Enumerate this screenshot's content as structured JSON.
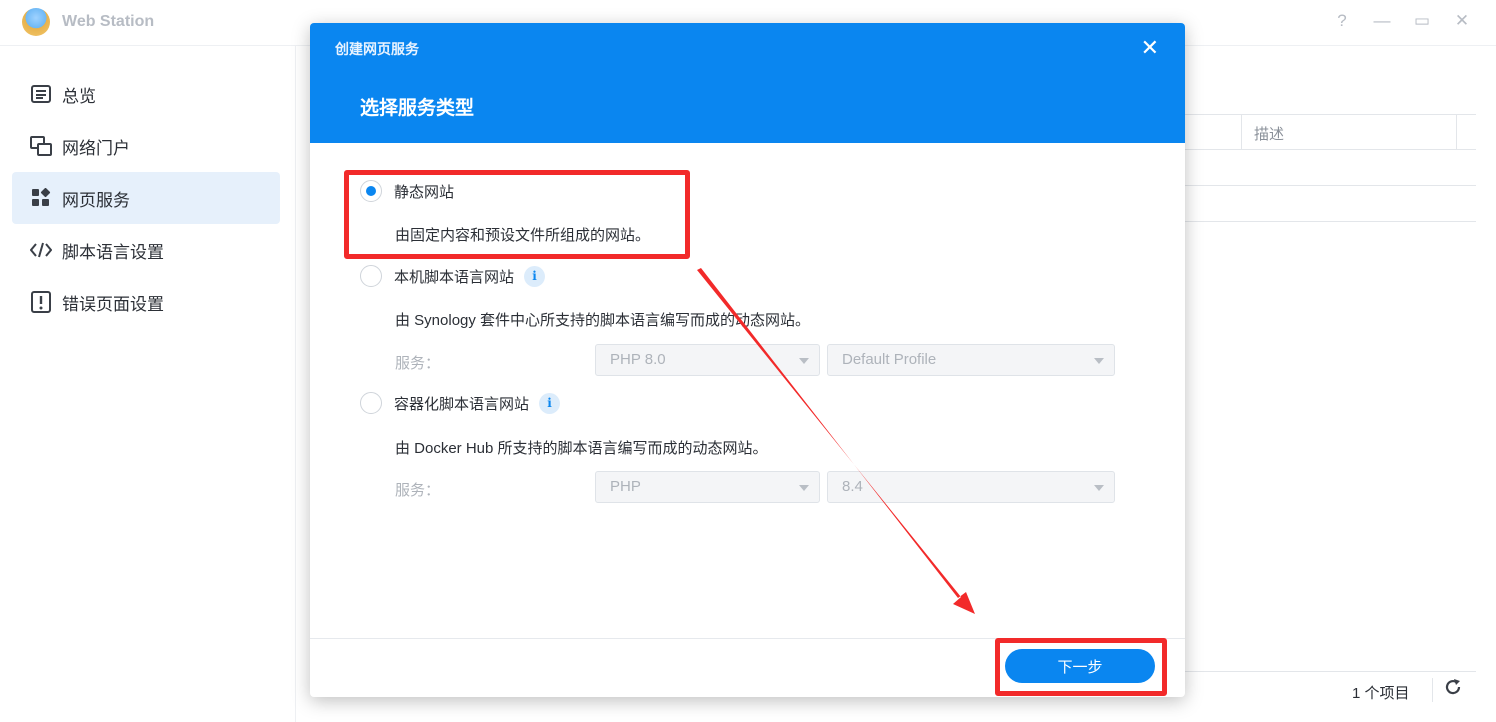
{
  "app": {
    "title": "Web Station",
    "controls": {
      "help": "?",
      "minimize": "—",
      "maximize": "▭",
      "close": "✕"
    }
  },
  "sidebar": {
    "items": [
      {
        "label": "总览",
        "icon": "overview-icon",
        "active": false
      },
      {
        "label": "网络门户",
        "icon": "portal-icon",
        "active": false
      },
      {
        "label": "网页服务",
        "icon": "web-service-icon",
        "active": true
      },
      {
        "label": "脚本语言设置",
        "icon": "code-icon",
        "active": false
      },
      {
        "label": "错误页面设置",
        "icon": "error-page-icon",
        "active": false
      }
    ]
  },
  "main": {
    "column_desc": "描述",
    "item_count": "1 个项目",
    "refresh_icon": "refresh-icon"
  },
  "dialog": {
    "title": "创建网页服务",
    "step_title": "选择服务类型",
    "close": "✕",
    "options": [
      {
        "label": "静态网站",
        "desc": "由固定内容和预设文件所组成的网站。",
        "checked": true
      },
      {
        "label": "本机脚本语言网站",
        "desc": "由 Synology 套件中心所支持的脚本语言编写而成的动态网站。",
        "checked": false,
        "service_label": "服务：",
        "select1": "PHP 8.0",
        "select2": "Default Profile"
      },
      {
        "label": "容器化脚本语言网站",
        "desc": "由 Docker Hub 所支持的脚本语言编写而成的动态网站。",
        "checked": false,
        "service_label": "服务：",
        "select1": "PHP",
        "select2": "8.4"
      }
    ],
    "info": "i",
    "next_label": "下一步"
  },
  "colors": {
    "primary": "#0a86f0",
    "annotation": "#f22a2a",
    "active_bg": "#e6f0fb"
  }
}
